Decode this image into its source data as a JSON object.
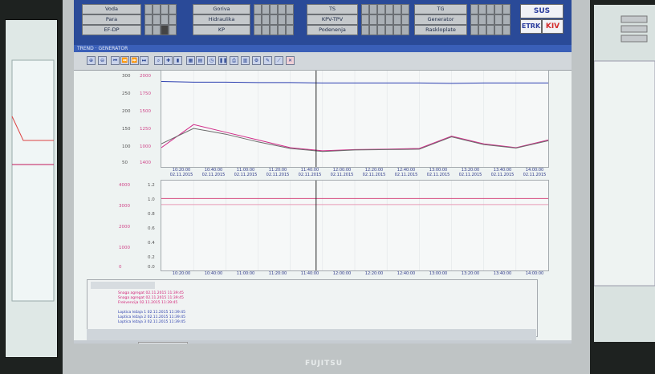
{
  "top_grid": {
    "col1": [
      "Voda",
      "Para",
      "EF-DP"
    ],
    "col2": [
      "Goriva",
      "Hidraulika",
      "KP"
    ],
    "col3": [
      "TS",
      "KPV-TPV",
      "Podenenja"
    ],
    "col4": [
      "TG",
      "Generator",
      "Raskloplate"
    ]
  },
  "logos": {
    "top": "SUS",
    "bottom_left": "ETRK",
    "bottom_right": "KIV"
  },
  "window_title": "TREND · GENERATOR",
  "toolbar_icons": [
    "zoom-in-icon",
    "zoom-out-icon",
    "first-icon",
    "rewind-icon",
    "fast-forward-icon",
    "last-icon",
    "search-icon",
    "crosshair-icon",
    "cursor-icon",
    "table-icon",
    "clock-icon",
    "pause-icon",
    "print-icon",
    "chart-icon",
    "settings-icon",
    "edit-icon",
    "close-icon"
  ],
  "chart_data": [
    {
      "type": "line",
      "y_left_ticks": [
        "300",
        "250",
        "200",
        "150",
        "100",
        "50"
      ],
      "y_left_red_ticks": [
        "2000",
        "1750",
        "1500",
        "1250",
        "1000",
        "1400"
      ],
      "x_ticks": [
        "10:20:00",
        "10:40:00",
        "11:00:00",
        "11:20:00",
        "11:40:00",
        "12:00:00",
        "12:20:00",
        "12:40:00",
        "13:00:00",
        "13:20:00",
        "13:40:00",
        "14:00:00"
      ],
      "x_date": "02.11.2015",
      "series": [
        {
          "color": "#2c3fb0",
          "values": [
            272,
            270,
            270,
            269,
            269,
            268,
            268,
            268,
            268,
            267,
            268,
            268,
            268
          ]
        },
        {
          "color": "#d12a88",
          "values": [
            100,
            160,
            140,
            120,
            100,
            92,
            95,
            96,
            98,
            130,
            110,
            100,
            120
          ]
        },
        {
          "color": "#6a6a6a",
          "values": [
            110,
            150,
            135,
            115,
            98,
            90,
            94,
            95,
            96,
            128,
            108,
            99,
            118
          ]
        }
      ]
    },
    {
      "type": "line",
      "y_ticks": [
        "1.2",
        "1.0",
        "0.8",
        "0.6",
        "0.4",
        "0.2",
        "0.0"
      ],
      "y_left_ticks": [
        "4000",
        "3000",
        "2000",
        "1000",
        "0"
      ],
      "x_ticks": [
        "10:20:00",
        "10:40:00",
        "11:00:00",
        "11:20:00",
        "11:40:00",
        "12:00:00",
        "12:20:00",
        "12:40:00",
        "13:00:00",
        "13:20:00",
        "13:40:00",
        "14:00:00"
      ],
      "series": [
        {
          "color": "#d64a7f",
          "values": [
            0.96,
            0.96,
            0.96,
            0.96,
            0.96,
            0.96,
            0.96,
            0.96,
            0.96,
            0.96,
            0.96,
            0.96,
            0.96
          ]
        },
        {
          "color": "#e89ab6",
          "values": [
            0.88,
            0.88,
            0.88,
            0.88,
            0.88,
            0.88,
            0.88,
            0.88,
            0.88,
            0.88,
            0.88,
            0.88,
            0.88
          ]
        }
      ]
    }
  ],
  "rows": [
    "Snaga agregat        02.11.2015 11:39:45",
    "Snaga agregat        02.11.2015 11:39:45",
    "Frekvencija           02.11.2015 11:39:45",
    "",
    "Loptica ležaja 1     02.11.2015 11:39:45",
    "Loptica ležaja 2     02.11.2015 11:39:45",
    "Loptica ležaja 3     02.11.2015 11:39:45"
  ],
  "status": {
    "label": "operator"
  },
  "brand": "FUJITSU"
}
